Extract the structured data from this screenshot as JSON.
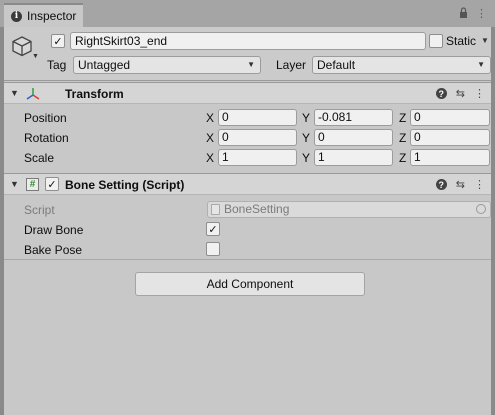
{
  "tab": {
    "title": "Inspector"
  },
  "gameobject": {
    "name": "RightSkirt03_end",
    "active": true,
    "static_label": "Static",
    "static": false,
    "tag_label": "Tag",
    "tag_value": "Untagged",
    "layer_label": "Layer",
    "layer_value": "Default"
  },
  "transform": {
    "title": "Transform",
    "rows": [
      {
        "label": "Position",
        "x": "0",
        "y": "-0.081",
        "z": "0"
      },
      {
        "label": "Rotation",
        "x": "0",
        "y": "0",
        "z": "0"
      },
      {
        "label": "Scale",
        "x": "1",
        "y": "1",
        "z": "1"
      }
    ],
    "axis_x": "X",
    "axis_y": "Y",
    "axis_z": "Z"
  },
  "bone_setting": {
    "title": "Bone Setting (Script)",
    "enabled": true,
    "script_label": "Script",
    "script_value": "BoneSetting",
    "draw_bone_label": "Draw Bone",
    "draw_bone": true,
    "bake_pose_label": "Bake Pose",
    "bake_pose": false
  },
  "add_component_label": "Add Component",
  "icons": {
    "tab": "info-icon",
    "gameobject": "cube-icon",
    "transform": "transform-axes-icon",
    "script": "csharp-script-icon",
    "help": "help-icon",
    "presets": "presets-icon",
    "menu": "kebab-menu-icon",
    "lock": "lock-icon"
  }
}
